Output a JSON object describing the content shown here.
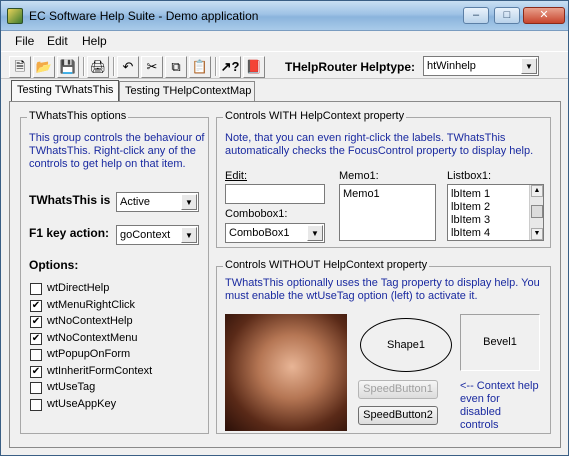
{
  "window": {
    "title": "EC Software Help Suite - Demo application"
  },
  "menu": {
    "file": "File",
    "edit": "Edit",
    "help": "Help"
  },
  "toolbar": {
    "helptype_label": "THelpRouter Helptype:",
    "helptype_value": "htWinhelp",
    "icons": [
      "new-icon",
      "open-icon",
      "save-icon",
      "print-icon",
      "undo-icon",
      "cut-icon",
      "copy-icon",
      "paste-icon",
      "whatsthis-icon",
      "help-book-icon"
    ]
  },
  "tabs": {
    "tab1": "Testing TWhatsThis",
    "tab2": "Testing THelpContextMap"
  },
  "options_group": {
    "title": "TWhatsThis options",
    "description": "This group controls the behaviour of TWhatsThis. Right-click any of the controls to get help on that item.",
    "whatsthis_label": "TWhatsThis is",
    "whatsthis_value": "Active",
    "f1_label": "F1 key action:",
    "f1_value": "goContext",
    "options_label": "Options:",
    "options": [
      {
        "label": "wtDirectHelp",
        "checked": false
      },
      {
        "label": "wtMenuRightClick",
        "checked": true
      },
      {
        "label": "wtNoContextHelp",
        "checked": true
      },
      {
        "label": "wtNoContextMenu",
        "checked": true
      },
      {
        "label": "wtPopupOnForm",
        "checked": false
      },
      {
        "label": "wtInheritFormContext",
        "checked": true
      },
      {
        "label": "wtUseTag",
        "checked": false
      },
      {
        "label": "wtUseAppKey",
        "checked": false
      }
    ]
  },
  "with_group": {
    "title": "Controls WITH HelpContext property",
    "description": "Note, that you can even right-click the labels. TWhatsThis automatically checks the FocusControl property to display help.",
    "edit_label": "Edit:",
    "edit_value": "",
    "combobox_label": "Combobox1:",
    "combobox_value": "ComboBox1",
    "memo_label": "Memo1:",
    "memo_value": "Memo1",
    "listbox_label": "Listbox1:",
    "listbox_items": [
      "lbItem 1",
      "lbItem 2",
      "lbItem 3",
      "lbItem 4"
    ]
  },
  "without_group": {
    "title": "Controls WITHOUT HelpContext property",
    "description": "TWhatsThis optionally uses the Tag property to display help. You must enable the wtUseTag option (left) to activate it.",
    "shape_label": "Shape1",
    "bevel_label": "Bevel1",
    "speedbutton1": "SpeedButton1",
    "speedbutton2": "SpeedButton2",
    "note": "<-- Context help even for disabled controls"
  }
}
